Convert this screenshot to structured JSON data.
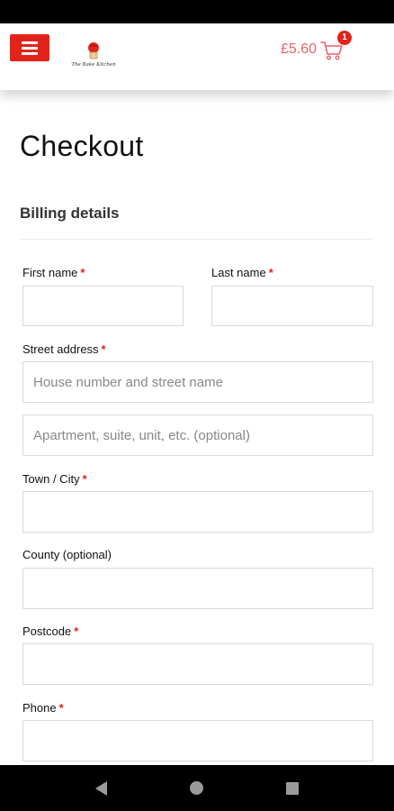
{
  "header": {
    "logo_text": "The Bake Kitchen",
    "cart_total": "£5.60",
    "cart_count": "1"
  },
  "page": {
    "title": "Checkout",
    "section_title": "Billing details"
  },
  "form": {
    "required_marker": "*",
    "first_name_label": "First name",
    "last_name_label": "Last name",
    "street_label": "Street address",
    "street_placeholder": "House number and street name",
    "apartment_placeholder": "Apartment, suite, unit, etc. (optional)",
    "city_label": "Town / City",
    "county_label": "County (optional)",
    "postcode_label": "Postcode",
    "phone_label": "Phone"
  },
  "colors": {
    "accent": "#e2231a",
    "cart_text": "#e9606a"
  }
}
